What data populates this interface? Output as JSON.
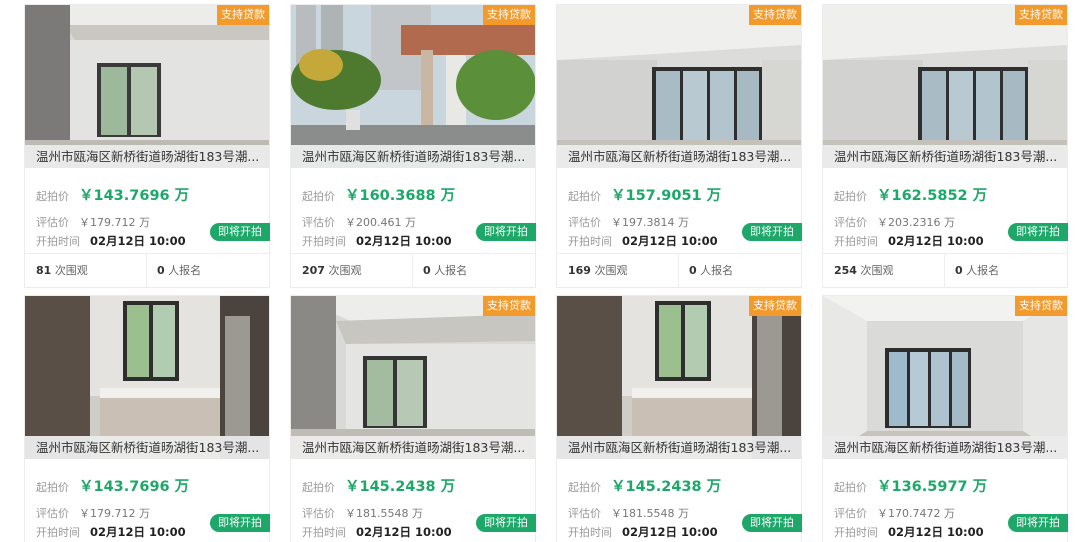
{
  "labels": {
    "start_price": "起拍价",
    "eval_price": "评估价",
    "start_time": "开拍时间",
    "loan_tag": "支持贷款",
    "status_badge": "即将开拍",
    "views_suffix": "次围观",
    "enroll_suffix": "人报名"
  },
  "colors": {
    "accent_green": "#1da869",
    "tag_orange": "#f39a2d"
  },
  "cards": [
    {
      "address": "温州市瓯海区新桥街道旸湖街183号潮...",
      "start_price": "￥143.7696 万",
      "eval_price": "￥179.712 万",
      "start_time": "02月12日 10:00",
      "views": "81",
      "enroll": "0",
      "photo": "room-window-left"
    },
    {
      "address": "温州市瓯海区新桥街道旸湖街183号潮...",
      "start_price": "￥160.3688 万",
      "eval_price": "￥200.461 万",
      "start_time": "02月12日 10:00",
      "views": "207",
      "enroll": "0",
      "photo": "community-gate"
    },
    {
      "address": "温州市瓯海区新桥街道旸湖街183号潮...",
      "start_price": "￥157.9051 万",
      "eval_price": "￥197.3814 万",
      "start_time": "02月12日 10:00",
      "views": "169",
      "enroll": "0",
      "photo": "living-room-balcony"
    },
    {
      "address": "温州市瓯海区新桥街道旸湖街183号潮...",
      "start_price": "￥162.5852 万",
      "eval_price": "￥203.2316 万",
      "start_time": "02月12日 10:00",
      "views": "254",
      "enroll": "0",
      "photo": "living-room-balcony"
    },
    {
      "address": "温州市瓯海区新桥街道旸湖街183号潮...",
      "start_price": "￥143.7696 万",
      "eval_price": "￥179.712 万",
      "start_time": "02月12日 10:00",
      "photo": "kitchen"
    },
    {
      "address": "温州市瓯海区新桥街道旸湖街183号潮...",
      "start_price": "￥145.2438 万",
      "eval_price": "￥181.5548 万",
      "start_time": "02月12日 10:00",
      "photo": "room-window-center"
    },
    {
      "address": "温州市瓯海区新桥街道旸湖街183号潮...",
      "start_price": "￥145.2438 万",
      "eval_price": "￥181.5548 万",
      "start_time": "02月12日 10:00",
      "photo": "kitchen"
    },
    {
      "address": "温州市瓯海区新桥街道旸湖街183号潮...",
      "start_price": "￥136.5977 万",
      "eval_price": "￥170.7472 万",
      "start_time": "02月12日 10:00",
      "photo": "bedroom-window"
    }
  ]
}
